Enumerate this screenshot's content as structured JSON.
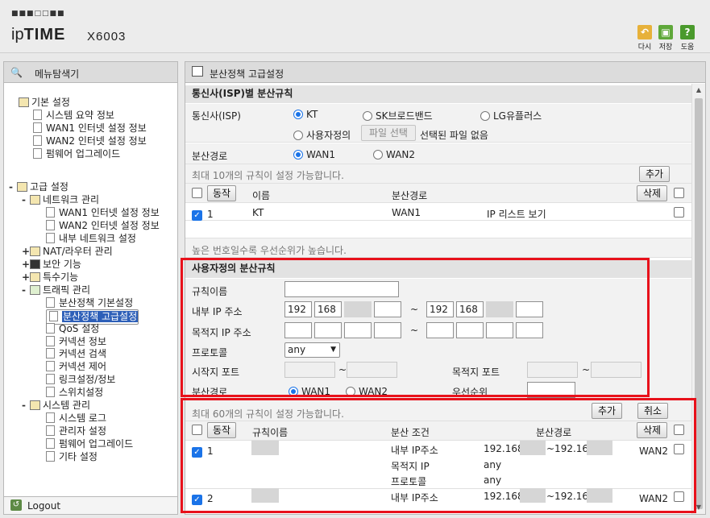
{
  "header": {
    "brand_dots": "■■■□□■■",
    "brand_ip": "ip",
    "brand_time": "TIME",
    "model": "X6003",
    "buttons": [
      {
        "label": "다시",
        "icon": "back-icon",
        "color": "#e7b13a",
        "glyph": "↶"
      },
      {
        "label": "저장",
        "icon": "save-icon",
        "color": "#5fa83a",
        "glyph": "▣"
      },
      {
        "label": "도움",
        "icon": "help-icon",
        "color": "#4a9a2c",
        "glyph": "?"
      }
    ]
  },
  "sidebar": {
    "title": "메뉴탐색기",
    "groups": [
      {
        "toggle": "",
        "label": "기본 설정",
        "items": [
          "시스템 요약 정보",
          "WAN1 인터넷 설정 정보",
          "WAN2 인터넷 설정 정보",
          "펌웨어 업그레이드"
        ]
      },
      {
        "toggle": "-",
        "label": "고급 설정"
      }
    ],
    "advanced": {
      "network": {
        "toggle": "-",
        "label": "네트워크 관리",
        "items": [
          "WAN1 인터넷 설정 정보",
          "WAN2 인터넷 설정 정보",
          "내부 네트워크 설정"
        ]
      },
      "nat": {
        "toggle": "+",
        "label": "NAT/라우터 관리"
      },
      "security": {
        "toggle": "+",
        "label": "보안 기능"
      },
      "special": {
        "toggle": "+",
        "label": "특수기능"
      },
      "traffic": {
        "toggle": "-",
        "label": "트래픽 관리",
        "items": [
          "분산정책 기본설정",
          "분산정책 고급설정",
          "QoS 설정",
          "커넥션 정보",
          "커넥션 검색",
          "커넥션 제어",
          "링크설정/정보",
          "스위치설정"
        ],
        "selected_index": 1
      },
      "system": {
        "toggle": "-",
        "label": "시스템 관리",
        "items": [
          "시스템 로그",
          "관리자 설정",
          "펌웨어 업그레이드",
          "기타 설정"
        ]
      }
    },
    "logout": "Logout"
  },
  "main": {
    "title": "분산정책 고급설정",
    "isp_section": {
      "title": "통신사(ISP)별 분산규칙",
      "isp_label": "통신사(ISP)",
      "isp_options": [
        "KT",
        "SK브로드밴드",
        "LG유플러스"
      ],
      "custom_option": "사용자정의",
      "file_button": "파일 선택",
      "file_status": "선택된 파일 없음",
      "route_label": "분산경로",
      "route_options": [
        "WAN1",
        "WAN2"
      ],
      "limit_note": "최대 10개의 규칙이 설정 가능합니다.",
      "add_button": "추가",
      "table_action": "동작",
      "col_name": "이름",
      "col_route": "분산경로",
      "delete_button": "삭제",
      "rows": [
        {
          "index": "1",
          "name": "KT",
          "route": "WAN1",
          "action": "IP 리스트 보기"
        }
      ]
    },
    "priority_note": "높은 번호일수록 우선순위가 높습니다.",
    "custom_section": {
      "title": "사용자정의 분산규칙",
      "rule_name": "규칙이름",
      "inner_ip": "내부 IP 주소",
      "inner_ip_start": [
        "192",
        "168"
      ],
      "inner_ip_end": [
        "192",
        "168"
      ],
      "dest_ip": "목적지 IP 주소",
      "tilde": "~",
      "protocol": "프로토콜",
      "protocol_value": "any",
      "start_port": "시작지 포트",
      "dest_port": "목적지 포트",
      "route_label": "분산경로",
      "route_options": [
        "WAN1",
        "WAN2"
      ],
      "priority": "우선순위"
    },
    "rules_section": {
      "limit_note": "최대 60개의 규칙이 설정 가능합니다.",
      "add_button": "추가",
      "cancel_button": "취소",
      "table_action": "동작",
      "col_name": "규칙이름",
      "col_cond": "분산 조건",
      "col_route": "분산경로",
      "delete_button": "삭제",
      "rows": [
        {
          "index": "1",
          "cond_inner": "내부 IP주소",
          "inner_start": "192.168",
          "inner_end": "~192.168",
          "cond_dest": "목적지 IP",
          "dest_val": "any",
          "cond_proto": "프로토콜",
          "proto_val": "any",
          "route": "WAN2"
        },
        {
          "index": "2",
          "cond_inner": "내부 IP주소",
          "inner_start": "192.168",
          "inner_end": "~192.168",
          "route": "WAN2"
        }
      ]
    }
  }
}
